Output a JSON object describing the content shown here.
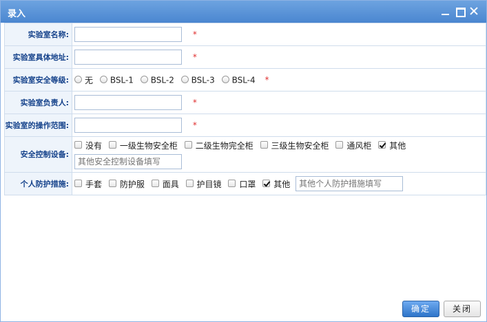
{
  "window": {
    "title": "录入"
  },
  "form": {
    "lab_name": {
      "label": "实验室名称:",
      "value": "",
      "required": "*"
    },
    "lab_address": {
      "label": "实验室具体地址:",
      "value": "",
      "required": "*"
    },
    "safety_level": {
      "label": "实验室安全等级:",
      "options": [
        "无",
        "BSL-1",
        "BSL-2",
        "BSL-3",
        "BSL-4"
      ],
      "selected": null,
      "required": "*"
    },
    "lab_owner": {
      "label": "实验室负责人:",
      "value": "",
      "required": "*"
    },
    "operation_scope": {
      "label": "实验室的操作范围:",
      "value": "",
      "required": "*"
    },
    "safety_devices": {
      "label": "安全控制设备:",
      "options": [
        {
          "label": "没有",
          "checked": false
        },
        {
          "label": "一级生物安全柜",
          "checked": false
        },
        {
          "label": "二级生物完全柜",
          "checked": false
        },
        {
          "label": "三级生物安全柜",
          "checked": false
        },
        {
          "label": "通风柜",
          "checked": false
        },
        {
          "label": "其他",
          "checked": true
        }
      ],
      "other_placeholder": "其他安全控制设备填写"
    },
    "ppe": {
      "label": "个人防护措施:",
      "options": [
        {
          "label": "手套",
          "checked": false
        },
        {
          "label": "防护服",
          "checked": false
        },
        {
          "label": "面具",
          "checked": false
        },
        {
          "label": "护目镜",
          "checked": false
        },
        {
          "label": "口罩",
          "checked": false
        },
        {
          "label": "其他",
          "checked": true
        }
      ],
      "other_placeholder": "其他个人防护措施填写"
    }
  },
  "buttons": {
    "ok": "确定",
    "close": "关闭"
  }
}
